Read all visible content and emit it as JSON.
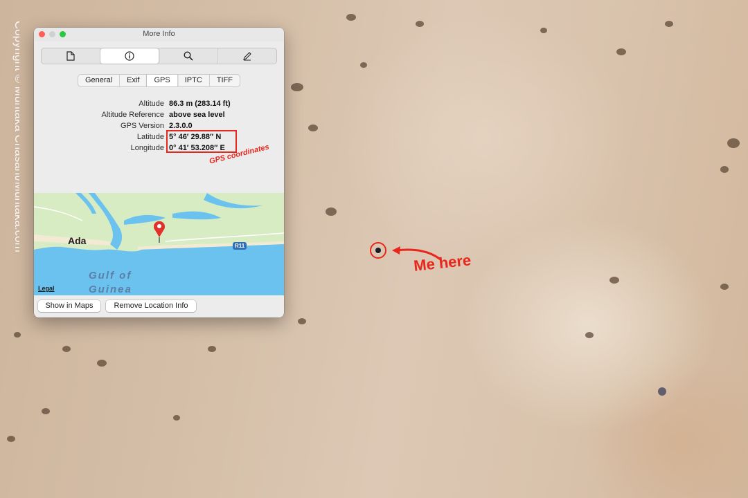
{
  "watermark": "Copyright © Muntaka Chasant/Muntaka.com",
  "window": {
    "title": "More Info",
    "toolbar": [
      {
        "icon": "document-icon"
      },
      {
        "icon": "info-icon"
      },
      {
        "icon": "magnifier-icon"
      },
      {
        "icon": "pencil-icon"
      }
    ],
    "tabs": [
      "General",
      "Exif",
      "GPS",
      "IPTC",
      "TIFF"
    ],
    "active_tab": "GPS",
    "gps": [
      {
        "label": "Altitude",
        "value": "86.3 m (283.14 ft)"
      },
      {
        "label": "Altitude Reference",
        "value": "above sea level"
      },
      {
        "label": "GPS Version",
        "value": "2.3.0.0"
      },
      {
        "label": "Latitude",
        "value": "5° 46′ 29.88″ N"
      },
      {
        "label": "Longitude",
        "value": "0° 41′ 53.208″ E"
      }
    ],
    "coords_annotation": "GPS coordinates",
    "map": {
      "place_label": "Ada",
      "sea_label_line1": "Gulf of",
      "sea_label_line2": "Guinea",
      "road_label": "R11",
      "legal_link": "Legal"
    },
    "buttons": {
      "show_in_maps": "Show in Maps",
      "remove_location": "Remove Location Info"
    }
  },
  "annotation": {
    "text": "Me here"
  },
  "colors": {
    "annotation_red": "#e8261c",
    "sea": "#6cc2ee",
    "land": "#d8ecc4",
    "pin": "#e0312a"
  }
}
